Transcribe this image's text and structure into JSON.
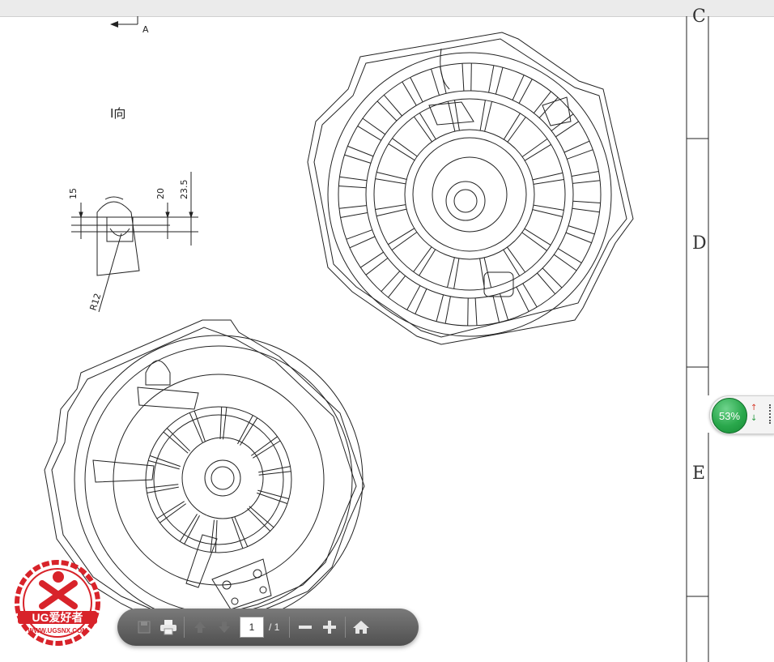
{
  "view_label": "I向",
  "section_arrow_label": "A",
  "dimensions": {
    "d1": "15",
    "d2": "20",
    "d3": "23.5",
    "radius": "R12"
  },
  "zones": [
    "C",
    "D",
    "E"
  ],
  "gauge": {
    "value": "53%"
  },
  "toolbar": {
    "page_current": "1",
    "page_separator": "/ 1"
  },
  "logo": {
    "brand": "UG爱好者",
    "url": "WWW.UGSNX.COM"
  },
  "colors": {
    "line": "#222222",
    "toolbar": "#5f5f5f",
    "gauge": "#2aa84c",
    "logo_red": "#d8232a"
  },
  "icons": [
    "save-icon",
    "print-icon",
    "page-up-icon",
    "page-down-icon",
    "zoom-out-icon",
    "zoom-in-icon",
    "home-icon"
  ]
}
